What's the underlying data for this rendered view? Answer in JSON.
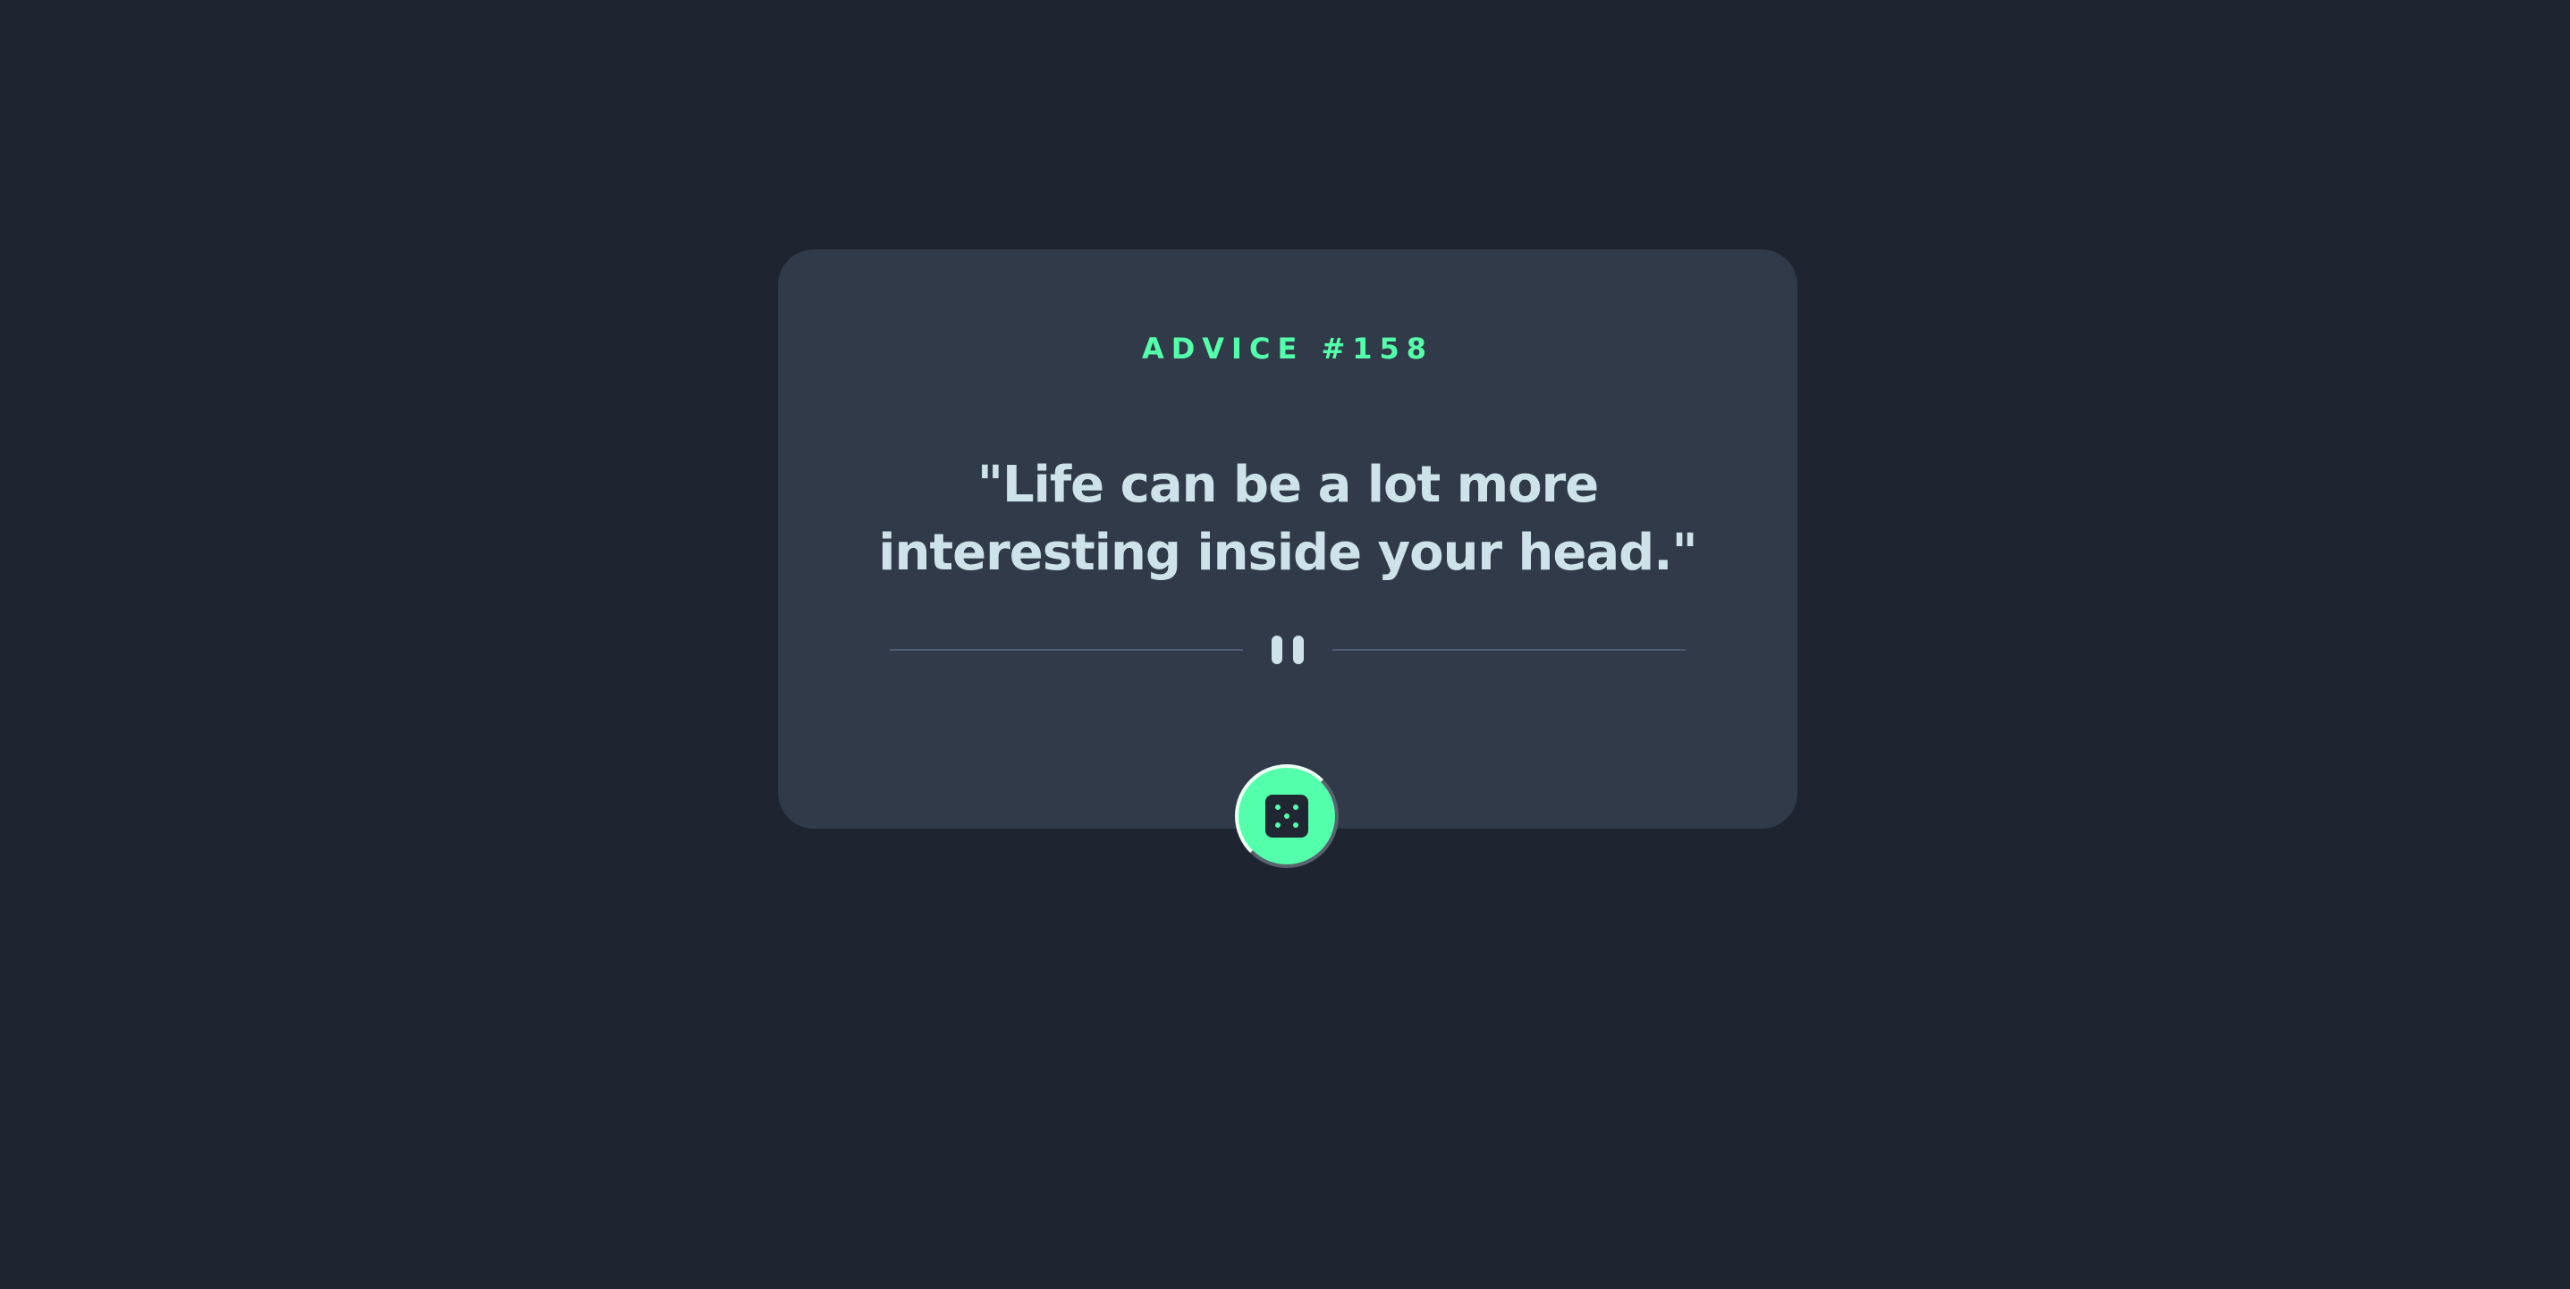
{
  "advice": {
    "label": "ADVICE #158",
    "quote": "\"Life can be a lot more interesting inside your head.\""
  },
  "colors": {
    "background": "#1f2431",
    "card": "#313a48",
    "accent": "#53ffaa",
    "text": "#cee3e9",
    "divider": "#4f5d74"
  },
  "icons": {
    "divider": "pause-icon",
    "button": "dice-icon"
  }
}
